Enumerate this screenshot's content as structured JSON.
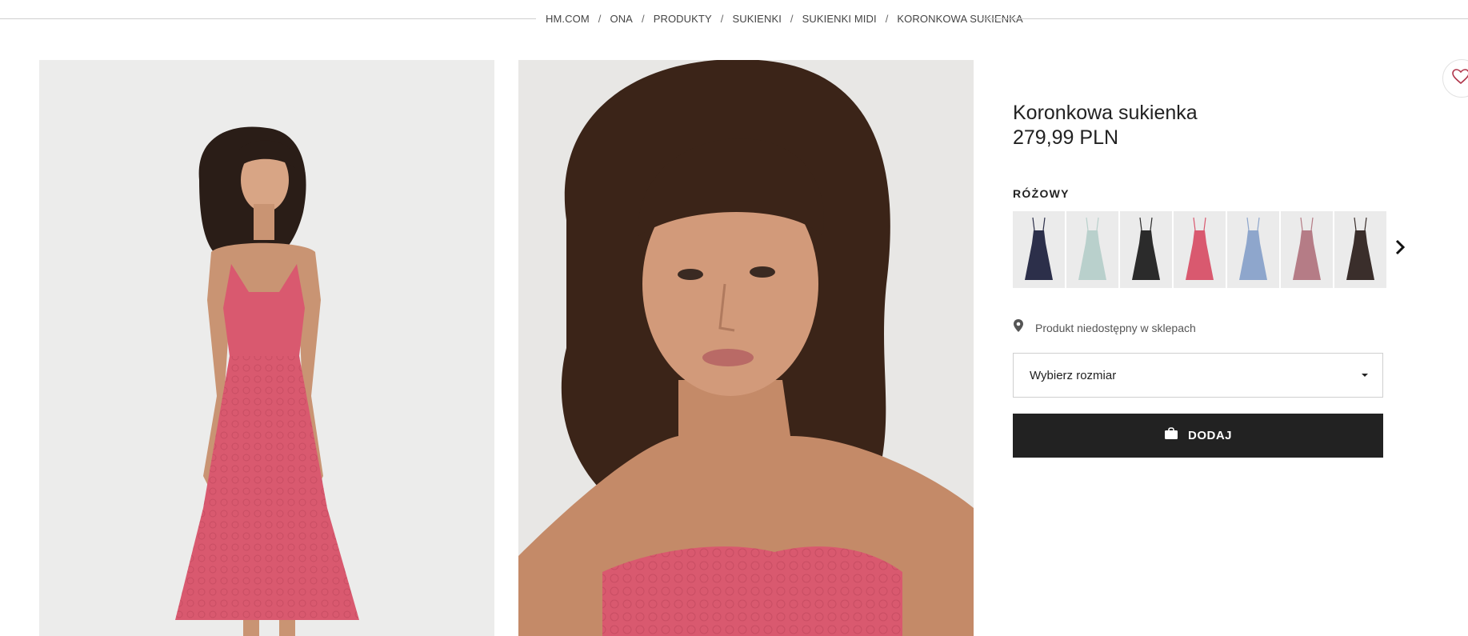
{
  "breadcrumb": {
    "items": [
      "HM.COM",
      "ONA",
      "PRODUKTY",
      "SUKIENKI",
      "SUKIENKI MIDI",
      "KORONKOWA SUKIENKA"
    ],
    "separator": "/"
  },
  "product": {
    "name": "Koronkowa sukienka",
    "price": "279,99 PLN",
    "color_label": "RÓŻOWY",
    "swatch_colors": [
      "#2c2f4a",
      "#b9d0cc",
      "#2b2b2b",
      "#d9596f",
      "#8ea6cc",
      "#b57c86",
      "#3a2e2b"
    ],
    "selected_swatch_index": 3,
    "availability": "Produkt niedostępny w sklepach",
    "size_placeholder": "Wybierz rozmiar",
    "add_button_label": "DODAJ"
  },
  "colors": {
    "accent_dark": "#222222",
    "dress_pink": "#d9596f"
  },
  "icons": {
    "favorite": "heart-icon",
    "location": "map-pin-icon",
    "bag": "shopping-bag-icon",
    "next": "chevron-right-icon"
  }
}
